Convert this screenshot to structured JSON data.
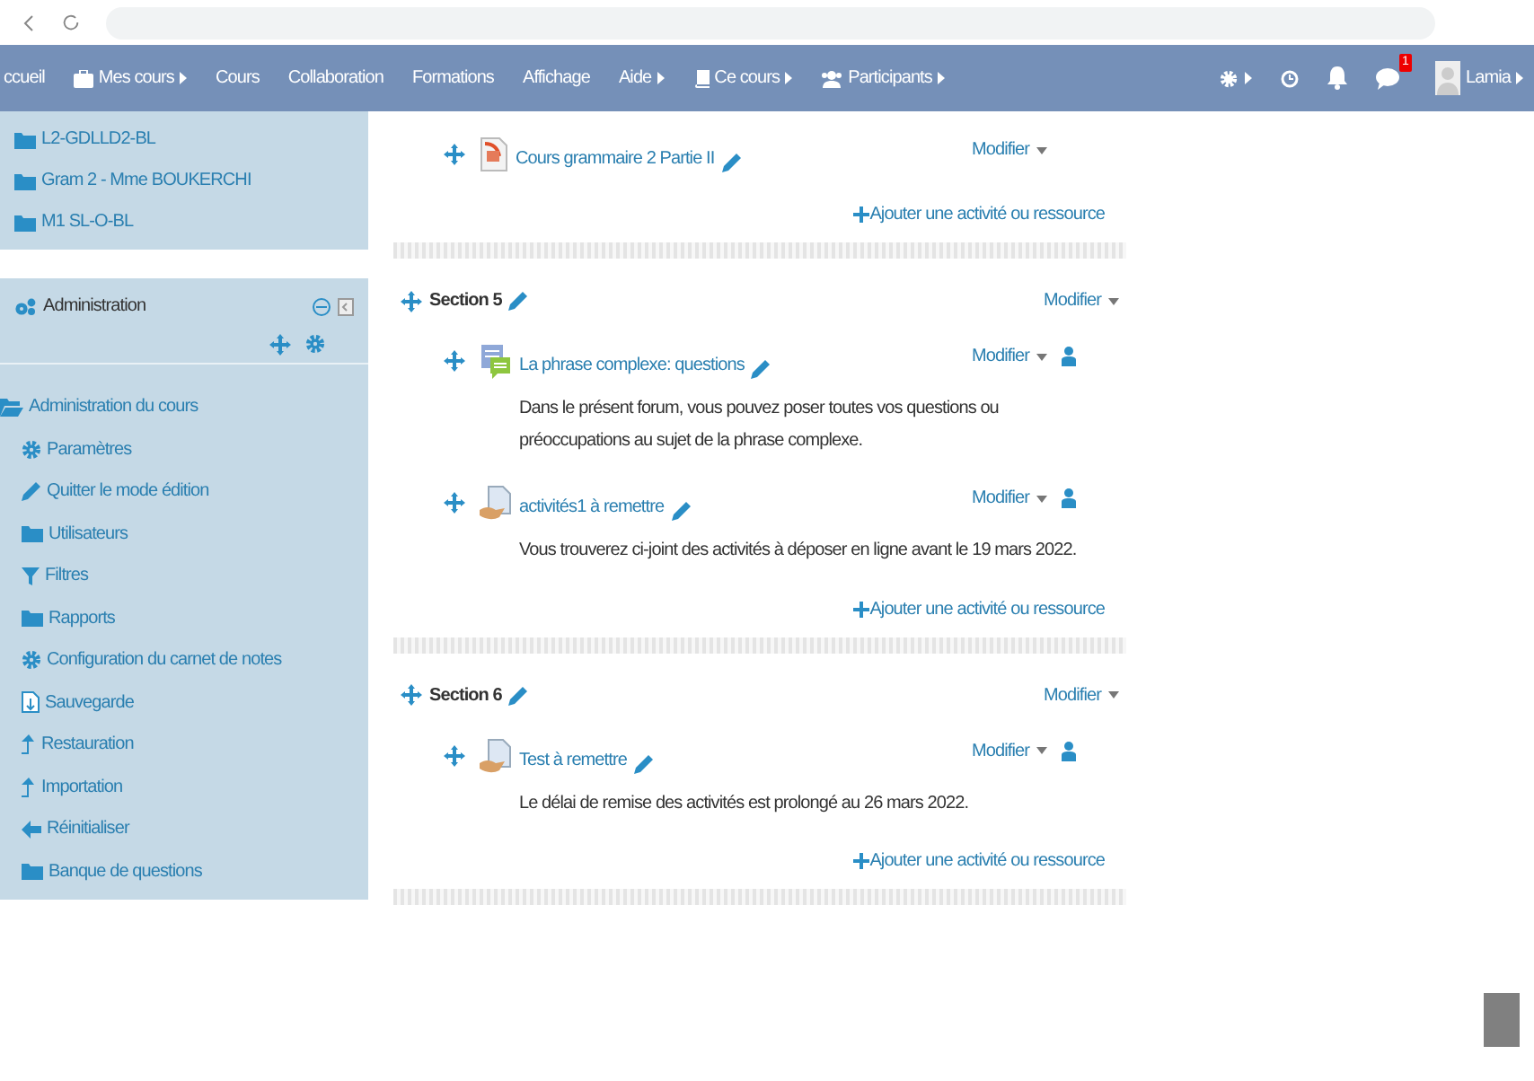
{
  "navbar": {
    "items": [
      {
        "label": "ccueil",
        "kind": "text",
        "caret": false
      },
      {
        "label": "Mes cours",
        "kind": "briefcase",
        "caret": true
      },
      {
        "label": "Cours",
        "kind": "text",
        "caret": false
      },
      {
        "label": "Collaboration",
        "kind": "text",
        "caret": false
      },
      {
        "label": "Formations",
        "kind": "text",
        "caret": false
      },
      {
        "label": "Affichage",
        "kind": "text",
        "caret": false
      },
      {
        "label": "Aide",
        "kind": "text",
        "caret": true
      },
      {
        "label": "Ce cours",
        "kind": "book",
        "caret": true
      },
      {
        "label": "Participants",
        "kind": "users",
        "caret": true
      }
    ],
    "message_badge": "1",
    "user": {
      "name": "Lamia"
    }
  },
  "course_list": [
    {
      "label": "L2-GDLLD2-BL"
    },
    {
      "label": "Gram 2 - Mme BOUKERCHI"
    },
    {
      "label": "M1 SL-O-BL"
    }
  ],
  "admin_block": {
    "title": "Administration",
    "items": [
      {
        "label": "Administration du cours",
        "kind": "folder-open",
        "children": [
          {
            "label": "Paramètres",
            "kind": "gear"
          },
          {
            "label": "Quitter le mode édition",
            "kind": "pencil"
          },
          {
            "label": "Utilisateurs",
            "kind": "folder"
          },
          {
            "label": "Filtres",
            "kind": "filter"
          },
          {
            "label": "Rapports",
            "kind": "folder"
          },
          {
            "label": "Configuration du carnet de notes",
            "kind": "gear"
          },
          {
            "label": "Sauvegarde",
            "kind": "backup"
          },
          {
            "label": "Restauration",
            "kind": "upload"
          },
          {
            "label": "Importation",
            "kind": "upload"
          },
          {
            "label": "Réinitialiser",
            "kind": "back"
          },
          {
            "label": "Banque de questions",
            "kind": "folder"
          }
        ]
      }
    ]
  },
  "sections": [
    {
      "items": [
        {
          "kind": "file",
          "name": "Cours grammaire 2 Partie II",
          "menu": "Modifier",
          "roles_icon": false
        }
      ],
      "add_link": "Ajouter une activité ou ressource"
    },
    {
      "title": "Section 5",
      "menu": "Modifier",
      "items": [
        {
          "kind": "forum",
          "name": "La phrase complexe: questions",
          "menu": "Modifier",
          "roles_icon": true,
          "description": "Dans le présent forum, vous pouvez poser toutes vos questions ou préoccupations au sujet de la phrase complexe."
        },
        {
          "kind": "assignment",
          "name": "activités1 à remettre",
          "menu": "Modifier",
          "roles_icon": true,
          "description": "Vous trouverez ci-joint des activités à déposer en ligne avant le 19 mars 2022."
        }
      ],
      "add_link": "Ajouter une activité ou ressource"
    },
    {
      "title": "Section 6",
      "menu": "Modifier",
      "items": [
        {
          "kind": "assignment",
          "name": "Test à remettre",
          "menu": "Modifier",
          "roles_icon": true,
          "description": "Le délai de remise des activités est prolongé au 26 mars 2022."
        }
      ],
      "add_link": "Ajouter une activité ou ressource"
    }
  ]
}
